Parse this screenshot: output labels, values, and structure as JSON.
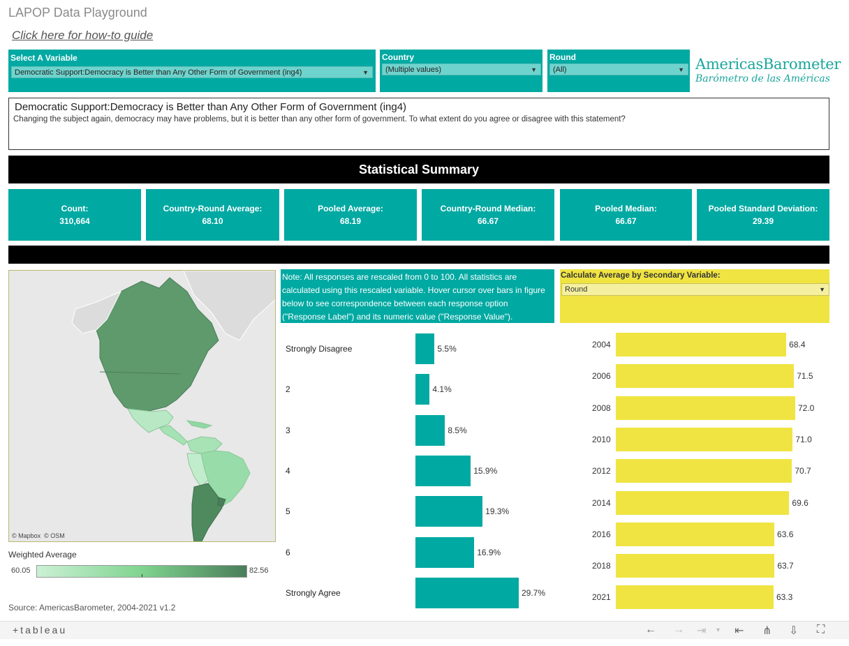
{
  "page": {
    "title": "LAPOP Data Playground",
    "guide_link": "Click here for how-to guide"
  },
  "filters": {
    "variable": {
      "label": "Select A Variable",
      "value": "Democratic Support:Democracy is Better than Any Other Form of Government (ing4)"
    },
    "country": {
      "label": "Country",
      "value": "(Multiple values)"
    },
    "round": {
      "label": "Round",
      "value": "(All)"
    }
  },
  "logo": {
    "line1": "AmericasBarometer",
    "line2": "Barómetro de las Américas"
  },
  "variable_box": {
    "title": "Democratic Support:Democracy is Better than Any Other Form of Government (ing4)",
    "description": "Changing the subject again, democracy may have problems, but it is better than any other form of government. To what extent do you agree or disagree with this statement?"
  },
  "summary": {
    "title": "Statistical Summary",
    "stats": [
      {
        "label": "Count:",
        "value": "310,664"
      },
      {
        "label": "Country-Round Average:",
        "value": "68.10"
      },
      {
        "label": "Pooled Average:",
        "value": "68.19"
      },
      {
        "label": "Country-Round Median:",
        "value": "66.67"
      },
      {
        "label": "Pooled Median:",
        "value": "66.67"
      },
      {
        "label": "Pooled Standard Deviation:",
        "value": "29.39"
      }
    ]
  },
  "map": {
    "credit_mapbox": "© Mapbox",
    "credit_osm": "© OSM",
    "legend_title": "Weighted Average",
    "legend_min": "60.05",
    "legend_max": "82.56"
  },
  "note": "Note: All responses are rescaled from 0 to 100. All statistics are calculated using this rescaled variable. Hover cursor over bars in figure below to see correspondence between each response option (\"Response Label\") and its numeric value (\"Response Value\").",
  "secondary": {
    "label": "Calculate Average by Secondary Variable:",
    "value": "Round"
  },
  "source": "Source: AmericasBarometer, 2004-2021 v1.2",
  "toolbar": {
    "brand": "+tableau"
  },
  "colors": {
    "teal": "#00a9a2",
    "yellow": "#f0e442",
    "map_high": "#4a7d5a",
    "map_low": "#ccf0d5"
  },
  "chart_data": [
    {
      "type": "bar",
      "orientation": "horizontal",
      "categories": [
        "Strongly Disagree",
        "2",
        "3",
        "4",
        "5",
        "6",
        "Strongly Agree"
      ],
      "values": [
        5.5,
        4.1,
        8.5,
        15.9,
        19.3,
        16.9,
        29.7
      ],
      "value_labels": [
        "5.5%",
        "4.1%",
        "8.5%",
        "15.9%",
        "19.3%",
        "16.9%",
        "29.7%"
      ],
      "unit": "%",
      "color": "#00a9a2"
    },
    {
      "type": "bar",
      "orientation": "horizontal",
      "categories": [
        "2004",
        "2006",
        "2008",
        "2010",
        "2012",
        "2014",
        "2016",
        "2018",
        "2021"
      ],
      "values": [
        68.4,
        71.5,
        72.0,
        71.0,
        70.7,
        69.6,
        63.6,
        63.7,
        63.3
      ],
      "value_labels": [
        "68.4",
        "71.5",
        "72.0",
        "71.0",
        "70.7",
        "69.6",
        "63.6",
        "63.7",
        "63.3"
      ],
      "color": "#f0e442"
    }
  ]
}
